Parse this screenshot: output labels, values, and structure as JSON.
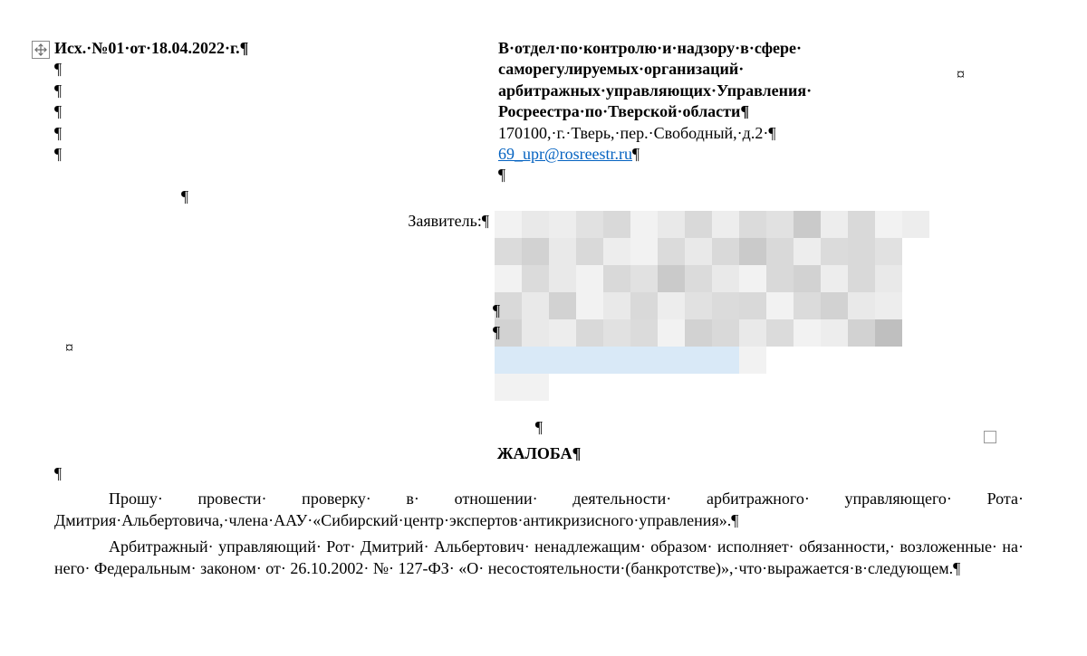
{
  "marks": {
    "pilcrow": "¶",
    "currency": "¤",
    "dot": "·",
    "nbhyphen": "­"
  },
  "header": {
    "outgoing": "Исх.·№01·от·18.04.2022·г.¶",
    "empty_pilcrows": [
      "¶",
      "¶",
      "¶",
      "¶",
      "¶"
    ]
  },
  "recipient": {
    "line1": "В·отдел·по·контролю·и·надзору·в·сфере·",
    "line2": "саморегулируемых·организаций·",
    "line3": "арбитражных·управляющих·Управления·",
    "line4": "Росреестра·по·Тверской·области¶",
    "address": "170100,·г.·Тверь,·пер.·Свободный,·д.2·¶",
    "email": "69_upr@rosreestr.ru",
    "email_tail": "¶",
    "blank": "¶"
  },
  "center_pilcrow": "¶",
  "applicant_label": "Заявитель:¶",
  "right_lone_pilcrows": [
    "¶",
    "¶"
  ],
  "center_pilcrow2": "¶",
  "title": "ЖАЛОБА¶",
  "post_title_pilcrow": "¶",
  "body": {
    "p1": "Прошу· провести· проверку· в· отношении· деятельности· арбитражного· управляющего· Рота· Дмитрия·Альбертовича,·члена·ААУ·«Сибирский·центр·экспертов·антикризисного·управления».¶",
    "p2": "Арбитражный· управляющий· Рот· Дмитрий· Альбертович· ненадлежащим· образом· исполняет· обязанности,· возложенные· на· него· Федеральным· законом· от· 26.10.2002· №· 127-ФЗ· «О· несостоятельности·(банкротстве)»,·что·выражается·в·следующем.¶"
  }
}
